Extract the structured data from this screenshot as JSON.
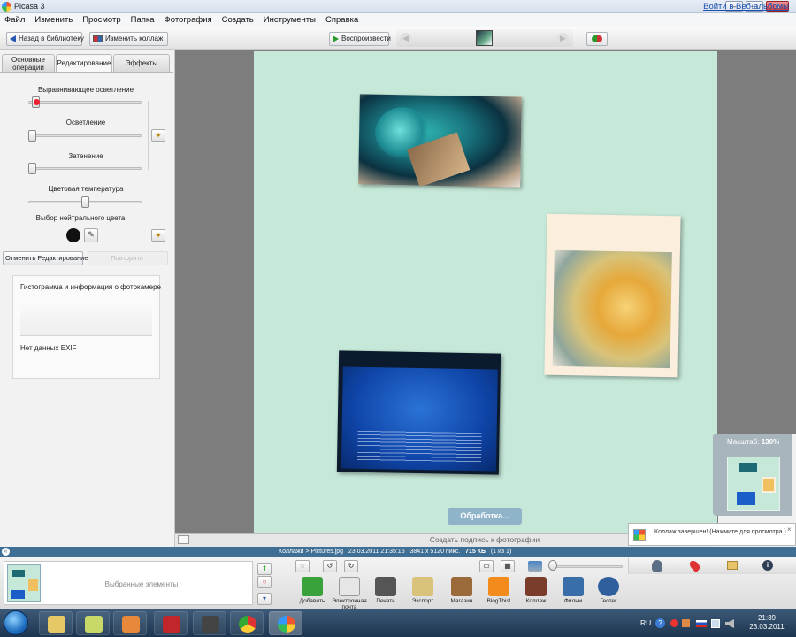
{
  "window": {
    "title": "Picasa 3",
    "btn_min": "–",
    "btn_max": "□",
    "btn_close": "✕"
  },
  "menu": [
    "Файл",
    "Изменить",
    "Просмотр",
    "Папка",
    "Фотография",
    "Создать",
    "Инструменты",
    "Справка"
  ],
  "signin_link": "Войти в Веб-альбомы",
  "toolbar": {
    "back_label": "Назад в библиотеку",
    "edit_collage_label": "Изменить коллаж",
    "play_label": "Воспроизвести"
  },
  "tabs": [
    {
      "label": "Основные операции",
      "active": false
    },
    {
      "label": "Редактирование",
      "active": true
    },
    {
      "label": "Эффекты",
      "active": false
    }
  ],
  "sliders": [
    {
      "label": "Выравнивающее осветление",
      "value": 0.03
    },
    {
      "label": "Осветление",
      "value": 0.0
    },
    {
      "label": "Затенение",
      "value": 0.0
    },
    {
      "label": "Цветовая температура",
      "value": 0.5
    }
  ],
  "neutral_color_label": "Выбор нейтрального цвета",
  "undo_edit_label": "Отменить Редактирование",
  "redo_label": "Повторить",
  "histogram": {
    "title": "Гистограмма и информация о фотокамере",
    "exif_text": "Нет данных EXIF"
  },
  "collage": {
    "processing_label": "Обработка...",
    "caption_placeholder": "Создать подпись к фотографии"
  },
  "zoom": {
    "label": "Масштаб:",
    "value": "130%"
  },
  "notification": "Коллаж завершен! (Нажмите для просмотра.)",
  "status": {
    "path": "Коллажи > Pictures.jpg",
    "datetime": "23.03.2011 21:35:15",
    "dimensions": "3841 x 5120 пикс.",
    "size": "715 КБ",
    "count": "(1 из 1)"
  },
  "tray": {
    "selected_label": "Выбранные элементы"
  },
  "actions": [
    {
      "label": "Добавить",
      "icon": "upload-arrow-icon",
      "color": "#3aa23a"
    },
    {
      "label": "Электронная почта",
      "icon": "envelope-icon",
      "color": "#e6e6e6"
    },
    {
      "label": "Печать",
      "icon": "printer-icon",
      "color": "#555555"
    },
    {
      "label": "Экспорт",
      "icon": "folder-icon",
      "color": "#d9c27a"
    },
    {
      "label": "Магазин",
      "icon": "book-icon",
      "color": "#9a6a3a"
    },
    {
      "label": "BlogThis!",
      "icon": "blogger-icon",
      "color": "#f28a1c"
    },
    {
      "label": "Коллаж",
      "icon": "collage-icon",
      "color": "#7a3d2b"
    },
    {
      "label": "Фильм",
      "icon": "film-icon",
      "color": "#3a6ea8"
    },
    {
      "label": "Геотег",
      "icon": "globe-icon",
      "color": "#2f5f9c"
    }
  ],
  "taskbar": {
    "lang": "RU",
    "time": "21:39",
    "date": "23.03.2011",
    "apps": [
      "explorer-folder-icon",
      "notes-icon",
      "media-player-icon",
      "filezilla-icon",
      "film-reel-icon",
      "chrome-icon",
      "picasa-icon"
    ]
  }
}
